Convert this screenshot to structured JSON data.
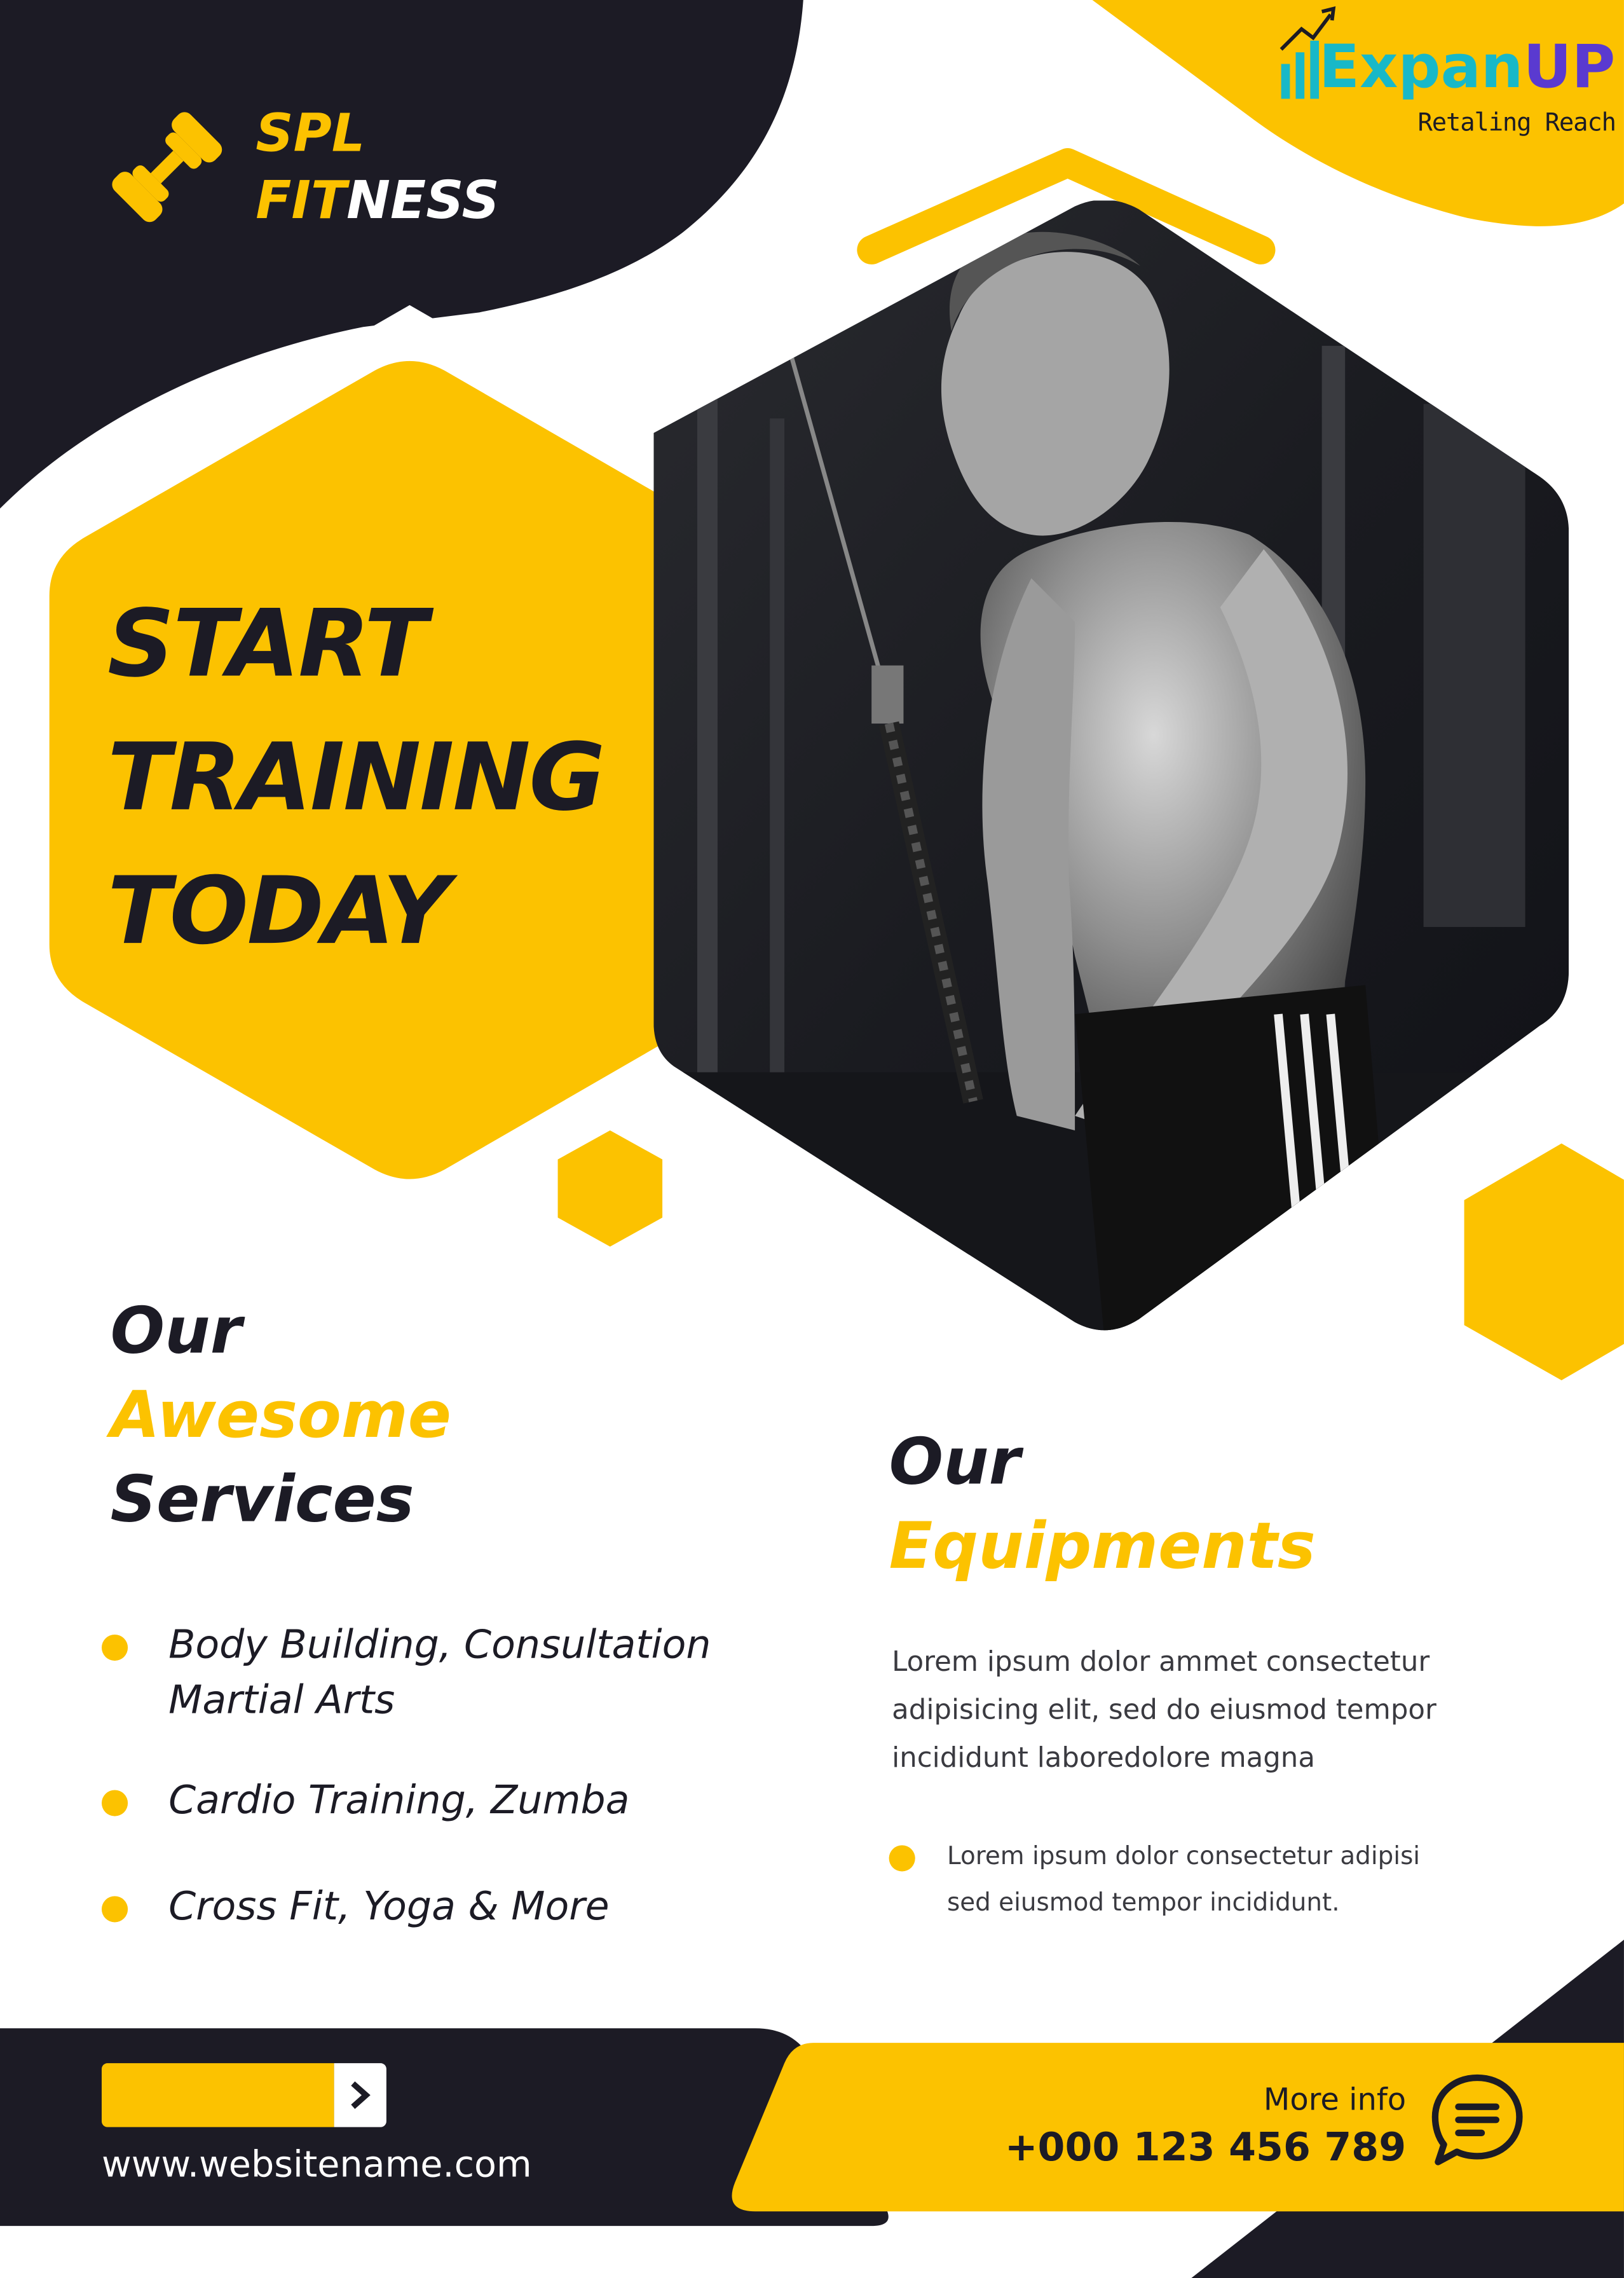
{
  "brand": {
    "line1": "SPL",
    "line2_a": "FIT",
    "line2_b": "NESS",
    "icon": "dumbbell-icon"
  },
  "partner_logo": {
    "name_a": "Expan",
    "name_b": "UP",
    "tagline": "Retaling Reach",
    "icon": "bar-chart-arrow-icon"
  },
  "hero": {
    "headline": [
      "START",
      "TRAINING",
      "TODAY"
    ],
    "photo": "athlete-cable-pushdown-photo"
  },
  "services": {
    "title_a": "Our",
    "title_b": "Awesome",
    "title_c": "Services",
    "items": [
      [
        "Body Building, Consultation",
        "Martial Arts"
      ],
      [
        "Cardio Training, Zumba"
      ],
      [
        "Cross Fit, Yoga & More"
      ]
    ]
  },
  "equipments": {
    "title_a": "Our",
    "title_b": "Equipments",
    "description": [
      "Lorem ipsum dolor ammet consectetur",
      "adipisicing elit, sed do eiusmod tempor",
      "incididunt laboredolore magna"
    ],
    "bullet": [
      "Lorem ipsum dolor consectetur adipisi",
      "sed eiusmod tempor incididunt."
    ]
  },
  "footer": {
    "website": "www.websitename.com",
    "more_info": "More info",
    "phone": "+000 123 456 789",
    "chat_icon": "chat-bubble-icon",
    "arrow_icon": "chevron-right-icon"
  },
  "colors": {
    "accent": "#fcc200",
    "dark": "#1c1b25",
    "white": "#ffffff"
  }
}
